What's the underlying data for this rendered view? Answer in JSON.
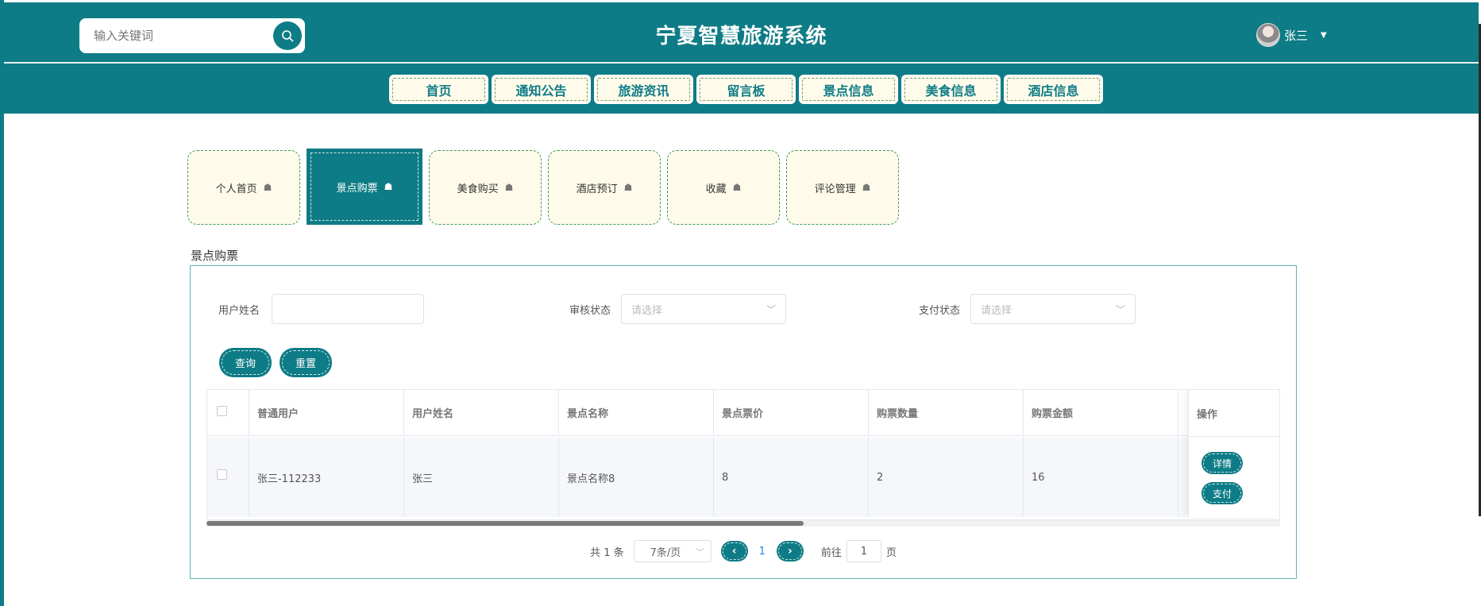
{
  "header": {
    "search_placeholder": "输入关键词",
    "title": "宁夏智慧旅游系统",
    "user_name": "张三"
  },
  "nav": [
    "首页",
    "通知公告",
    "旅游资讯",
    "留言板",
    "景点信息",
    "美食信息",
    "酒店信息"
  ],
  "center_tabs": [
    "个人首页",
    "景点购票",
    "美食购买",
    "酒店预订",
    "收藏",
    "评论管理"
  ],
  "active_tab": "景点购票",
  "section_title": "景点购票",
  "filters": {
    "user_name_label": "用户姓名",
    "audit_status_label": "审核状态",
    "audit_status_placeholder": "请选择",
    "pay_status_label": "支付状态",
    "pay_status_placeholder": "请选择"
  },
  "buttons": {
    "query": "查询",
    "reset": "重置"
  },
  "table": {
    "columns": [
      "普通用户",
      "用户姓名",
      "景点名称",
      "景点票价",
      "购票数量",
      "购票金额"
    ],
    "ops_header": "操作",
    "rows": [
      {
        "normal_user": "张三-112233",
        "user_name": "张三",
        "scenic_name": "景点名称8",
        "price": "8",
        "qty": "2",
        "amount": "16"
      }
    ],
    "row_actions": [
      "详情",
      "支付"
    ]
  },
  "pagination": {
    "total_text": "共 1 条",
    "page_size": "7条/页",
    "current_page": "1",
    "goto_label": "前往",
    "goto_value": "1",
    "page_unit": "页"
  },
  "colors": {
    "primary": "#0e7c86",
    "tab_bg": "#fffbea"
  }
}
